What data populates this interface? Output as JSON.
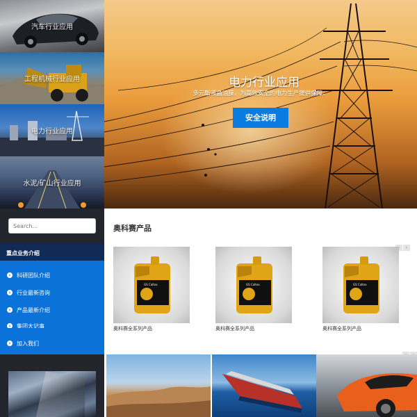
{
  "sidebar": {
    "tiles": [
      {
        "label": "汽车行业应用"
      },
      {
        "label": "工程机械行业应用"
      },
      {
        "label": "电力行业应用"
      },
      {
        "label": "水泥/矿山行业应用"
      }
    ],
    "search_placeholder": "Search...",
    "nav_header": "重点业务介绍",
    "nav_items": [
      {
        "label": "科研团队介绍",
        "icon": "chevron-right-icon"
      },
      {
        "label": "行业最新咨询",
        "icon": "chevron-right-icon"
      },
      {
        "label": "产品最新介绍",
        "icon": "chevron-right-icon"
      },
      {
        "label": "集团大记事",
        "icon": "chevron-right-icon"
      },
      {
        "label": "加入我们",
        "icon": "chevron-right-icon"
      }
    ]
  },
  "hero": {
    "title": "电力行业应用",
    "subtitle": "多元酯液晶油膜，为高效安全的电力生产提供保障。",
    "button_label": "安全说明"
  },
  "products": {
    "section_title": "奥科赛产品",
    "items": [
      {
        "name": "奥科赛全系列产品",
        "label_brand": "GS Caltex"
      },
      {
        "name": "奥科赛全系列产品",
        "label_brand": "GS Caltex"
      },
      {
        "name": "奥科赛全系列产品",
        "label_brand": "GS Caltex"
      }
    ],
    "prev_icon": "chevron-left-icon",
    "next_icon": "chevron-right-icon"
  },
  "colors": {
    "accent": "#0a72d8",
    "nav_header_bg": "#0f2a55",
    "sidebar_bg": "#22252b",
    "oil_gold": "#e0a417"
  }
}
